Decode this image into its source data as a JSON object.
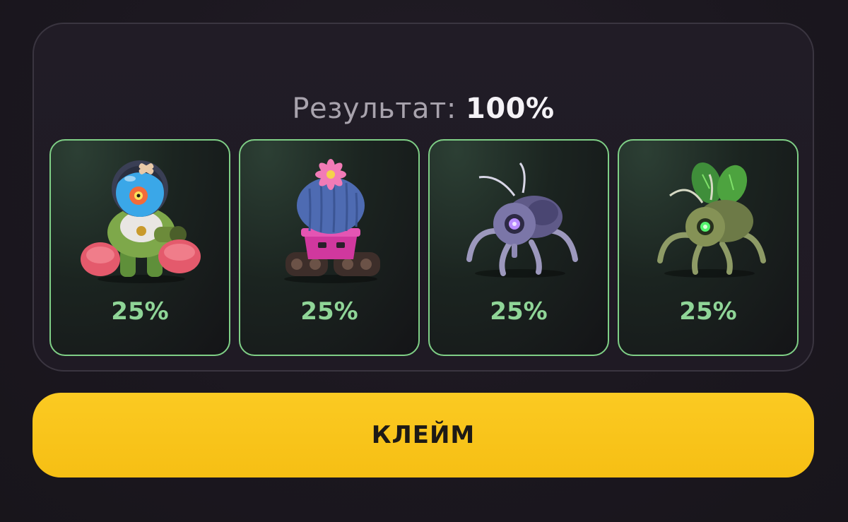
{
  "result": {
    "label": "Результат:",
    "value": "100%"
  },
  "cards": [
    {
      "percent": "25%",
      "icon": "diver-robot-icon"
    },
    {
      "percent": "25%",
      "icon": "cactus-tank-icon"
    },
    {
      "percent": "25%",
      "icon": "purple-spider-bot-icon"
    },
    {
      "percent": "25%",
      "icon": "green-fly-bot-icon"
    }
  ],
  "claim_button": {
    "label": "КЛЕЙМ"
  },
  "colors": {
    "accent": "#f6bf14",
    "card_border": "#7fcf86",
    "percent_text": "#8fd597",
    "background": "#1c1820"
  }
}
